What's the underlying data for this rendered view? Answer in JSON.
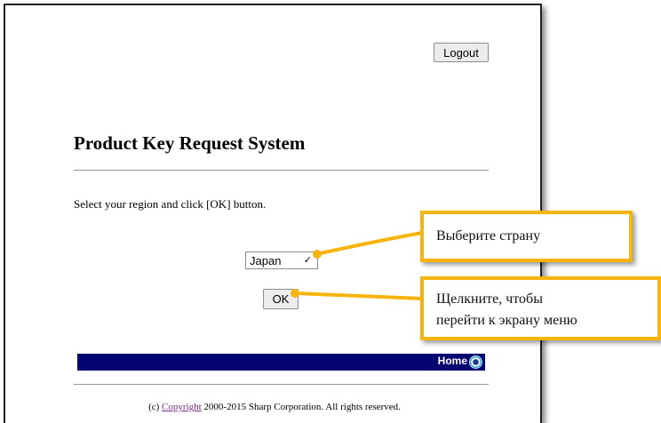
{
  "header": {
    "logout_label": "Logout"
  },
  "main": {
    "title": "Product Key Request System",
    "instruction": "Select your region and click [OK] button.",
    "region_select": {
      "selected": "Japan"
    },
    "ok_label": "OK"
  },
  "navbar": {
    "home_label": "Home",
    "home_icon": "home-icon"
  },
  "footer": {
    "prefix": "(c) ",
    "copyright_link": "Copyright",
    "suffix": " 2000-2015 Sharp Corporation. All rights reserved."
  },
  "callouts": {
    "select_country": "Выберите страну",
    "click_to_menu_line1": "Щелкните, чтобы",
    "click_to_menu_line2": "перейти к экрану меню",
    "accent_color": "#f6b40d"
  },
  "colors": {
    "navbar": "#050572",
    "link_visited": "#7a2a8c"
  }
}
